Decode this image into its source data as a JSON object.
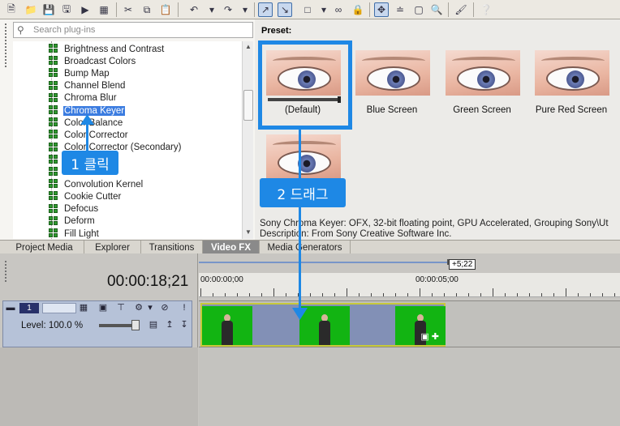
{
  "toolbar": {
    "icons": [
      "new-file-icon",
      "open-icon",
      "save-icon",
      "save-as-icon",
      "render-icon",
      "properties-icon",
      "cut-icon",
      "copy-icon",
      "paste-icon",
      "undo-icon",
      "redo-icon",
      "normal-edit-tool-icon",
      "envelope-tool-icon",
      "selection-tool-icon",
      "snapping-icon",
      "auto-crossfade-icon",
      "auto-ripple-icon",
      "lock-envelopes-icon",
      "ignore-grouping-icon",
      "marker-icon",
      "region-icon",
      "zoom-icon",
      "shuffle-icon",
      "help-icon"
    ]
  },
  "plugins": {
    "search_placeholder": "Search plug-ins",
    "items": [
      {
        "label": "Brightness and Contrast",
        "selected": false
      },
      {
        "label": "Broadcast Colors",
        "selected": false
      },
      {
        "label": "Bump Map",
        "selected": false
      },
      {
        "label": "Channel Blend",
        "selected": false
      },
      {
        "label": "Chroma Blur",
        "selected": false
      },
      {
        "label": "Chroma Keyer",
        "selected": true
      },
      {
        "label": "Color Balance",
        "selected": false
      },
      {
        "label": "Color Corrector",
        "selected": false
      },
      {
        "label": "Color Corrector (Secondary)",
        "selected": false
      },
      {
        "label": "",
        "selected": false
      },
      {
        "label": "",
        "selected": false
      },
      {
        "label": "Convolution Kernel",
        "selected": false
      },
      {
        "label": "Cookie Cutter",
        "selected": false
      },
      {
        "label": "Defocus",
        "selected": false
      },
      {
        "label": "Deform",
        "selected": false
      },
      {
        "label": "Fill Light",
        "selected": false
      }
    ]
  },
  "presets": {
    "label": "Preset:",
    "items": [
      {
        "name": "(Default)"
      },
      {
        "name": "Blue Screen"
      },
      {
        "name": "Green Screen"
      },
      {
        "name": "Pure Red Screen"
      },
      {
        "name": ""
      }
    ],
    "description_line1": "Sony Chroma Keyer: OFX, 32-bit floating point, GPU Accelerated, Grouping Sony\\Ut",
    "description_line2": "Description: From Sony Creative Software Inc."
  },
  "tabs": [
    {
      "label": "Project Media",
      "active": false
    },
    {
      "label": "Explorer",
      "active": false
    },
    {
      "label": "Transitions",
      "active": false
    },
    {
      "label": "Video FX",
      "active": true
    },
    {
      "label": "Media Generators",
      "active": false
    }
  ],
  "timeline": {
    "timecode": "00:00:18;21",
    "duration_badge": "+5;22",
    "ruler_labels": [
      "00:00:00;00",
      "00:00:05;00"
    ],
    "track_number": "1",
    "level_label": "Level: 100.0 %",
    "level_value": 1.0
  },
  "annotations": {
    "step1": "1 클릭",
    "step2": "2 드래그",
    "accent": "#1e88e5"
  }
}
